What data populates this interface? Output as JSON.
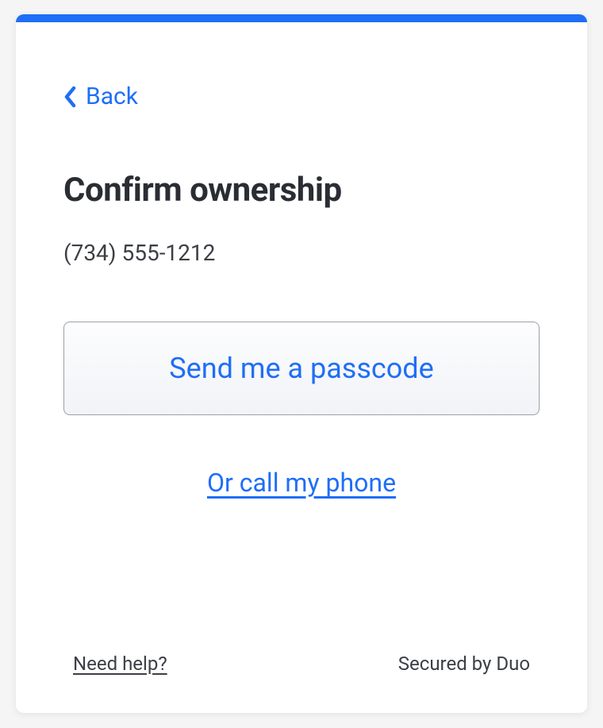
{
  "nav": {
    "back_label": "Back"
  },
  "main": {
    "title": "Confirm ownership",
    "phone": "(734) 555-1212",
    "passcode_button_label": "Send me a passcode",
    "call_link_label": "Or call my phone"
  },
  "footer": {
    "help_label": "Need help?",
    "secured_label": "Secured by Duo"
  },
  "colors": {
    "accent": "#1f6ef7"
  }
}
